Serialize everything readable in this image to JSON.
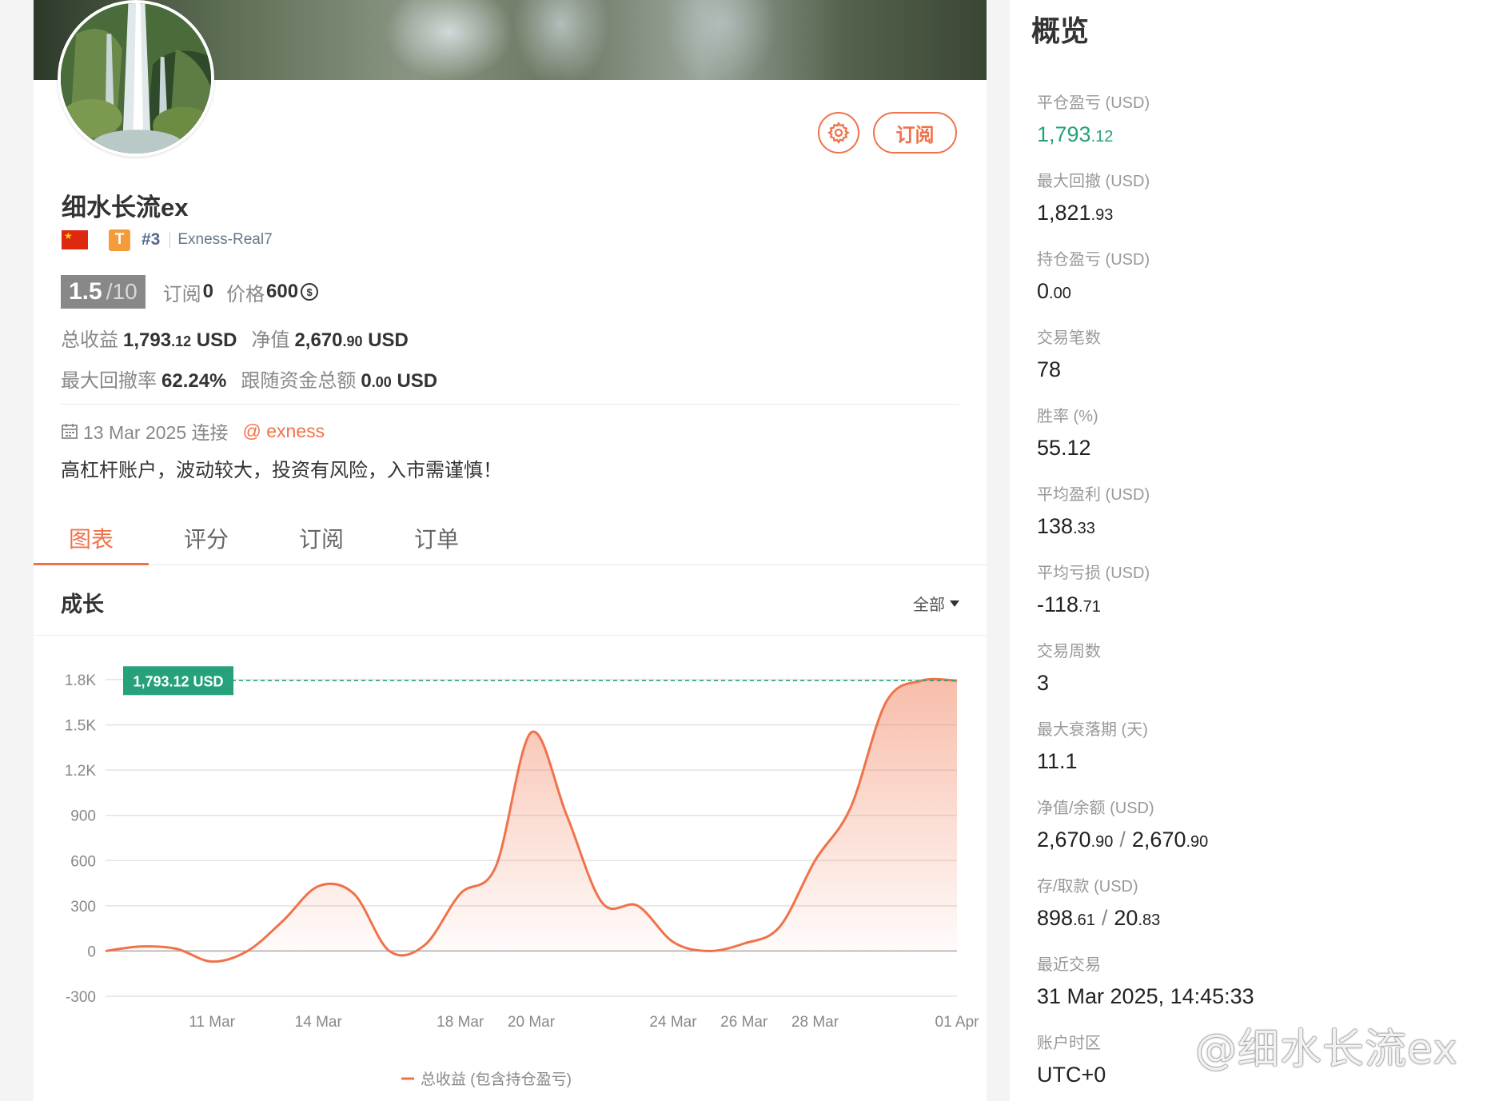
{
  "profile": {
    "name": "细水长流ex",
    "rank": "#3",
    "tier_badge": "T",
    "server": "Exness-Real7",
    "subscribe_label": "订阅",
    "score": "1.5",
    "score_max": "/10",
    "subscriptions_label": "订阅",
    "subscriptions_value": "0",
    "price_label": "价格",
    "price_value": "600",
    "coin_symbol": "$",
    "total_return_label": "总收益",
    "total_return_int": "1,793",
    "total_return_dec": ".12",
    "total_return_unit": "USD",
    "equity_label": "净值",
    "equity_int": "2,670",
    "equity_dec": ".90",
    "equity_unit": "USD",
    "max_drawdown_label": "最大回撤率",
    "max_drawdown_value": "62.24%",
    "follow_funds_label": "跟随资金总额",
    "follow_funds_int": "0",
    "follow_funds_dec": ".00",
    "follow_funds_unit": "USD",
    "connected_text": "13 Mar 2025 连接",
    "broker_link": "@ exness",
    "description": "高杠杆账户，波动较大，投资有风险，入市需谨慎！"
  },
  "tabs": [
    {
      "label": "图表",
      "active": true
    },
    {
      "label": "评分",
      "active": false
    },
    {
      "label": "订阅",
      "active": false
    },
    {
      "label": "订单",
      "active": false
    }
  ],
  "chart_section": {
    "title": "成长",
    "range_label": "全部"
  },
  "chart_data": {
    "type": "area",
    "x": [
      "08 Mar",
      "09 Mar",
      "10 Mar",
      "11 Mar",
      "12 Mar",
      "13 Mar",
      "14 Mar",
      "15 Mar",
      "16 Mar",
      "17 Mar",
      "18 Mar",
      "19 Mar",
      "20 Mar",
      "21 Mar",
      "22 Mar",
      "23 Mar",
      "24 Mar",
      "25 Mar",
      "26 Mar",
      "27 Mar",
      "28 Mar",
      "29 Mar",
      "30 Mar",
      "31 Mar",
      "01 Apr"
    ],
    "x_ticks": [
      "11 Mar",
      "14 Mar",
      "18 Mar",
      "20 Mar",
      "24 Mar",
      "26 Mar",
      "28 Mar",
      "01 Apr"
    ],
    "series": [
      {
        "name": "总收益 (包含持仓盈亏)",
        "color": "#f0724a",
        "values": [
          0,
          30,
          15,
          -70,
          0,
          200,
          430,
          380,
          0,
          40,
          380,
          560,
          1450,
          900,
          320,
          300,
          60,
          0,
          50,
          160,
          600,
          950,
          1650,
          1793.12,
          1793.12
        ]
      }
    ],
    "y_ticks": [
      "1.8K",
      "1.5K",
      "1.2K",
      "900",
      "600",
      "300",
      "0",
      "-300"
    ],
    "ylim": [
      -300,
      1800
    ],
    "reference_label": "1,793.12 USD",
    "reference_value": 1793.12,
    "reference_color": "#26a17b",
    "grid": true,
    "legend_position": "bottom"
  },
  "overview": {
    "title": "概览",
    "metrics": [
      {
        "label": "平仓盈亏 (USD)",
        "main": "1,793",
        "dec": ".12",
        "green": true
      },
      {
        "label": "最大回撤 (USD)",
        "main": "1,821",
        "dec": ".93"
      },
      {
        "label": "持仓盈亏 (USD)",
        "main": "0",
        "dec": ".00"
      },
      {
        "label": "交易笔数",
        "main": "78",
        "dec": ""
      },
      {
        "label": "胜率 (%)",
        "main": "55.12",
        "dec": ""
      },
      {
        "label": "平均盈利 (USD)",
        "main": "138",
        "dec": ".33"
      },
      {
        "label": "平均亏损 (USD)",
        "main": "-118",
        "dec": ".71"
      },
      {
        "label": "交易周数",
        "main": "3",
        "dec": ""
      },
      {
        "label": "最大衰落期 (天)",
        "main": "11.1",
        "dec": ""
      },
      {
        "label": "净值/余额 (USD)",
        "main": "2,670",
        "dec": ".90",
        "main2": "2,670",
        "dec2": ".90"
      },
      {
        "label": "存/取款 (USD)",
        "main": "898",
        "dec": ".61",
        "main2": "20",
        "dec2": ".83"
      },
      {
        "label": "最近交易",
        "main": "31 Mar 2025, 14:45:33",
        "dec": ""
      },
      {
        "label": "账户时区",
        "main": "UTC+0",
        "dec": ""
      }
    ]
  },
  "watermark": "@细水长流ex",
  "colors": {
    "accent": "#f0724a",
    "green": "#26a17b"
  }
}
